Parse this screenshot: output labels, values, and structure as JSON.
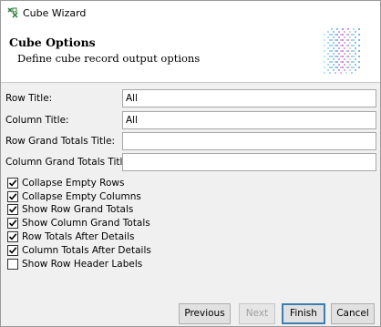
{
  "window": {
    "title": "Cube Wizard",
    "icon": "cube-wizard-app-icon"
  },
  "header": {
    "title": "Cube Options",
    "subtitle": "Define cube record output options",
    "graphic": "cube-dots-graphic"
  },
  "fields": [
    {
      "label": "Row Title:",
      "value": "All"
    },
    {
      "label": "Column Title:",
      "value": "All"
    },
    {
      "label": "Row Grand Totals Title:",
      "value": ""
    },
    {
      "label": "Column Grand Totals Title:",
      "value": ""
    }
  ],
  "options": [
    {
      "label": "Collapse Empty Rows",
      "checked": true
    },
    {
      "label": "Collapse Empty Columns",
      "checked": true
    },
    {
      "label": "Show Row Grand Totals",
      "checked": true
    },
    {
      "label": "Show Column Grand Totals",
      "checked": true
    },
    {
      "label": "Row Totals After Details",
      "checked": true
    },
    {
      "label": "Column Totals After Details",
      "checked": true
    },
    {
      "label": "Show Row Header Labels",
      "checked": false
    }
  ],
  "buttons": {
    "previous": "Previous",
    "next": "Next",
    "finish": "Finish",
    "cancel": "Cancel"
  }
}
